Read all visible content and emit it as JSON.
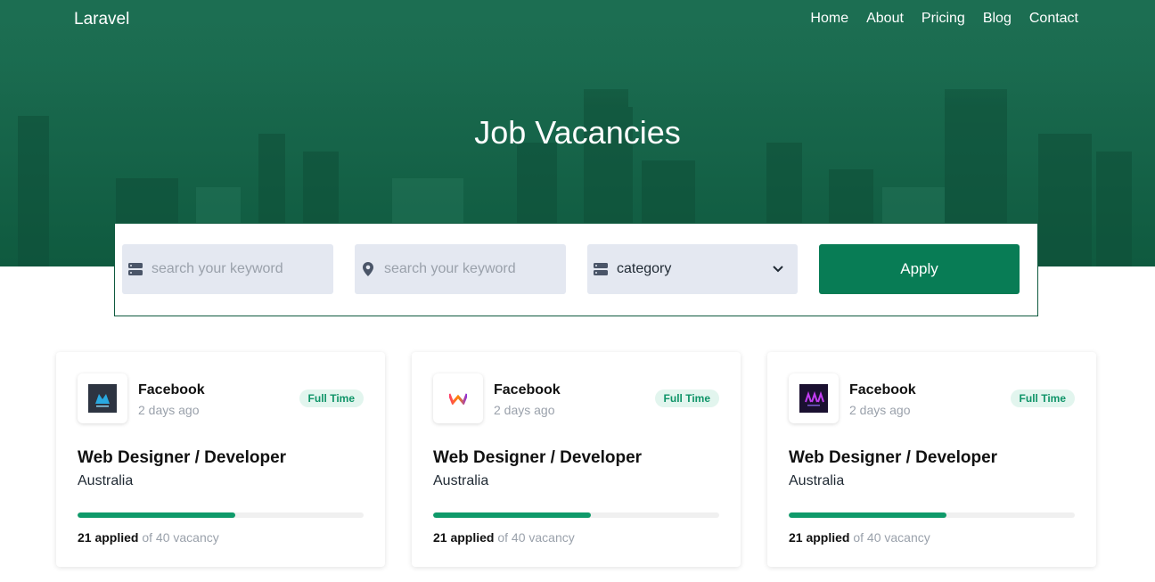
{
  "nav": {
    "brand": "Laravel",
    "links": [
      "Home",
      "About",
      "Pricing",
      "Blog",
      "Contact"
    ]
  },
  "hero": {
    "title": "Job Vacancies"
  },
  "search": {
    "keyword_placeholder": "search your keyword",
    "location_placeholder": "search your keyword",
    "category_value": "category",
    "apply_label": "Apply"
  },
  "jobs": [
    {
      "company": "Facebook",
      "posted": "2 days ago",
      "type": "Full Time",
      "title": "Web Designer / Developer",
      "location": "Australia",
      "applied": "21 applied",
      "of_text": "of 40 vacancy",
      "applied_fraction": 0.55,
      "logo": "dark-square-logo"
    },
    {
      "company": "Facebook",
      "posted": "2 days ago",
      "type": "Full Time",
      "title": "Web Designer / Developer",
      "location": "Australia",
      "applied": "21 applied",
      "of_text": "of 40 vacancy",
      "applied_fraction": 0.55,
      "logo": "gradient-w-logo"
    },
    {
      "company": "Facebook",
      "posted": "2 days ago",
      "type": "Full Time",
      "title": "Web Designer / Developer",
      "location": "Australia",
      "applied": "21 applied",
      "of_text": "of 40 vacancy",
      "applied_fraction": 0.55,
      "logo": "purple-dark-logo"
    }
  ],
  "colors": {
    "primary": "#087c55",
    "hero_green": "#166449",
    "badge_bg": "#e2f5ee",
    "badge_text": "#0f9468",
    "field_bg": "#e4e8f1"
  }
}
